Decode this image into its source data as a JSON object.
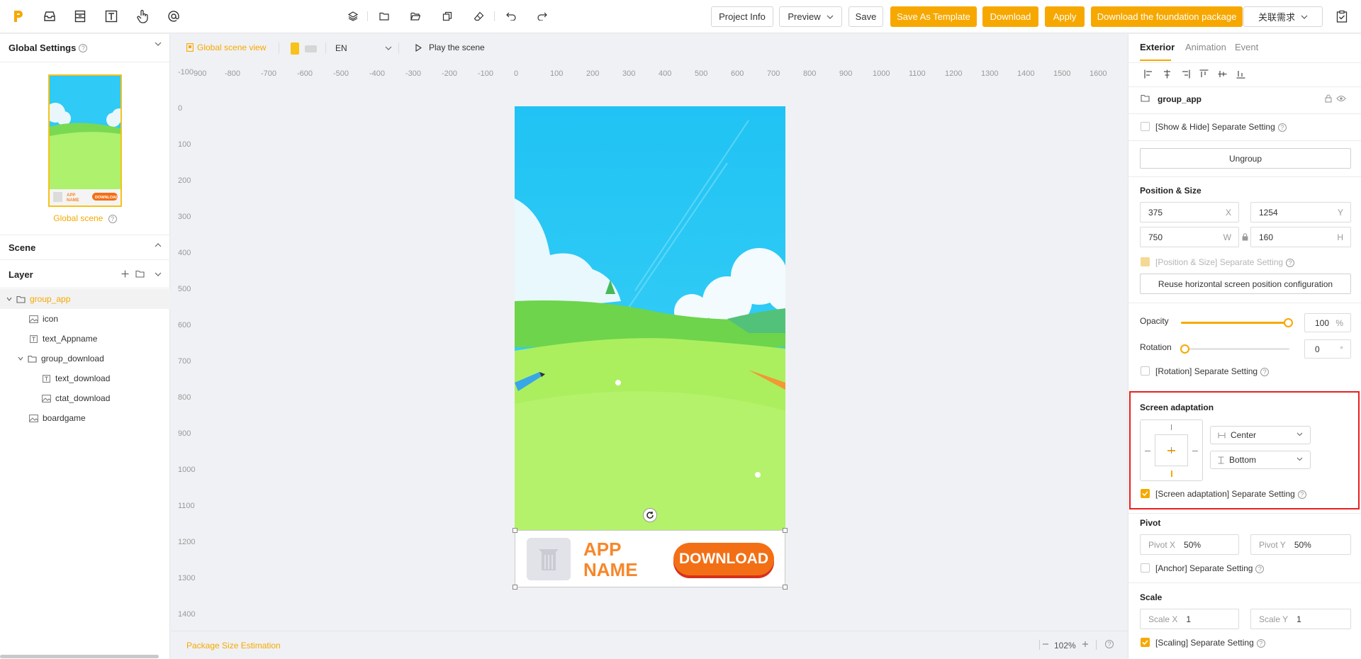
{
  "toolbar": {
    "project_info": "Project Info",
    "preview": "Preview",
    "save": "Save",
    "save_as_template": "Save As Template",
    "download": "Download",
    "apply": "Apply",
    "download_foundation": "Download the foundation package",
    "requirements": "关联需求"
  },
  "left": {
    "global_settings": "Global Settings",
    "global_scene": "Global scene",
    "scene": "Scene",
    "layer": "Layer",
    "thumb": {
      "app_name": "APP\nNAME",
      "download": "DOWNLOAD"
    },
    "tree": [
      {
        "label": "group_app",
        "type": "folder"
      },
      {
        "label": "icon",
        "type": "image"
      },
      {
        "label": "text_Appname",
        "type": "text"
      },
      {
        "label": "group_download",
        "type": "folder"
      },
      {
        "label": "text_download",
        "type": "text"
      },
      {
        "label": "ctat_download",
        "type": "image"
      },
      {
        "label": "boardgame",
        "type": "image"
      }
    ]
  },
  "canvas": {
    "global_scene_view": "Global scene view",
    "language": "EN",
    "play_scene": "Play the scene",
    "ruler_h": [
      "-100",
      "900",
      "-800",
      "-700",
      "-600",
      "-500",
      "-400",
      "-300",
      "-200",
      "-100",
      "0",
      "100",
      "200",
      "300",
      "400",
      "500",
      "600",
      "700",
      "800",
      "900",
      "1000",
      "1100",
      "1200",
      "1300",
      "1400",
      "1500",
      "1600"
    ],
    "ruler_v": [
      "0",
      "100",
      "200",
      "300",
      "400",
      "500",
      "600",
      "700",
      "800",
      "900",
      "1000",
      "1100",
      "1200",
      "1300",
      "1400"
    ],
    "banner": {
      "app_line1": "APP",
      "app_line2": "NAME",
      "download": "DOWNLOAD"
    },
    "package_size": "Package Size Estimation",
    "zoom": "102%"
  },
  "right": {
    "tabs": [
      "Exterior",
      "Animation",
      "Event"
    ],
    "active_tab": "Exterior",
    "node_name": "group_app",
    "show_hide": "[Show & Hide] Separate Setting",
    "ungroup": "Ungroup",
    "position_size": "Position & Size",
    "x_value": "375",
    "x_label": "X",
    "y_value": "1254",
    "y_label": "Y",
    "w_value": "750",
    "w_label": "W",
    "h_value": "160",
    "h_label": "H",
    "pos_separate": "[Position & Size] Separate Setting",
    "reuse_horizontal": "Reuse horizontal screen position configuration",
    "opacity_label": "Opacity",
    "opacity_value": "100",
    "opacity_unit": "%",
    "opacity_fraction": 1.0,
    "rotation_label": "Rotation",
    "rotation_value": "0",
    "rotation_unit": "°",
    "rotation_separate": "[Rotation] Separate Setting",
    "screen_adaptation": "Screen adaptation",
    "h_align": "Center",
    "v_align": "Bottom",
    "screen_separate": "[Screen adaptation] Separate Setting",
    "pivot": "Pivot",
    "pivot_x_label": "Pivot X",
    "pivot_x_value": "50%",
    "pivot_y_label": "Pivot Y",
    "pivot_y_value": "50%",
    "anchor_separate": "[Anchor] Separate Setting",
    "scale": "Scale",
    "scale_x_label": "Scale X",
    "scale_x_value": "1",
    "scale_y_label": "Scale Y",
    "scale_y_value": "1",
    "scaling_separate": "[Scaling] Separate Setting"
  },
  "colors": {
    "accent": "#f7a800",
    "highlight_border": "#e8201f",
    "sky": "#29c6f3",
    "grass": "#a9ec5a",
    "download_btn": "#f36f15"
  }
}
